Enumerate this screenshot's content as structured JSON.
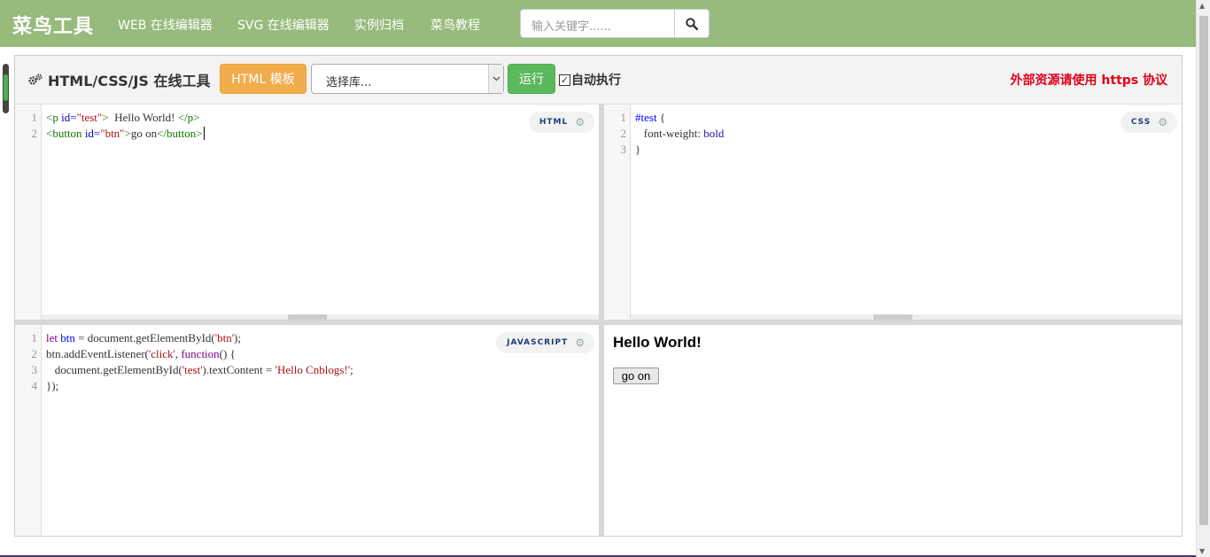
{
  "nav": {
    "brand": "菜鸟工具",
    "links": [
      "WEB 在线编辑器",
      "SVG 在线编辑器",
      "实例归档",
      "菜鸟教程"
    ],
    "search_placeholder": "输入关键字......"
  },
  "toolbar": {
    "title": "HTML/CSS/JS 在线工具",
    "template_button": "HTML 模板",
    "library_select": "选择库...",
    "run_button": "运行",
    "auto_run_checked": true,
    "auto_run_label": "自动执行",
    "https_note": "外部资源请使用 https 协议"
  },
  "html_pane": {
    "badge": "HTML",
    "line_numbers": [
      "1",
      "2"
    ],
    "lines": {
      "l1": {
        "t1": "<p",
        "t2": " id=",
        "t3": "\"test\"",
        "t4": ">",
        "t5": "  Hello World! ",
        "t6": "</p>"
      },
      "l2": {
        "t1": "<button",
        "t2": " id=",
        "t3": "\"btn\"",
        "t4": ">",
        "t5": "go on",
        "t6": "</button>"
      }
    }
  },
  "css_pane": {
    "badge": "CSS",
    "line_numbers": [
      "1",
      "2",
      "3"
    ],
    "lines": {
      "l1": {
        "sel": "#test",
        "brace": " {"
      },
      "l2": {
        "prop": "   font-weight",
        "colon": ": ",
        "val": "bold"
      },
      "l3": {
        "brace": "}"
      }
    }
  },
  "js_pane": {
    "badge": "JAVASCRIPT",
    "line_numbers": [
      "1",
      "2",
      "3",
      "4"
    ],
    "lines": {
      "l1": {
        "kw": "let",
        "def": " btn",
        "rest": " = document.getElementById(",
        "str": "'btn'",
        "end": ");"
      },
      "l2": {
        "a": "btn.addEventListener(",
        "str": "'click'",
        "b": ", ",
        "kw": "function",
        "c": "() {"
      },
      "l3": {
        "a": "   document.getElementById(",
        "str1": "'test'",
        "b": ").textContent = ",
        "str2": "'Hello Cnblogs!'",
        "c": ";"
      },
      "l4": {
        "a": "});"
      }
    }
  },
  "result": {
    "heading": "Hello World!",
    "button": "go on"
  },
  "colors": {
    "nav_bg": "#96bb7c",
    "template_btn": "#f0ad4e",
    "run_btn": "#5cb85c",
    "https_note": "#e0001a"
  }
}
